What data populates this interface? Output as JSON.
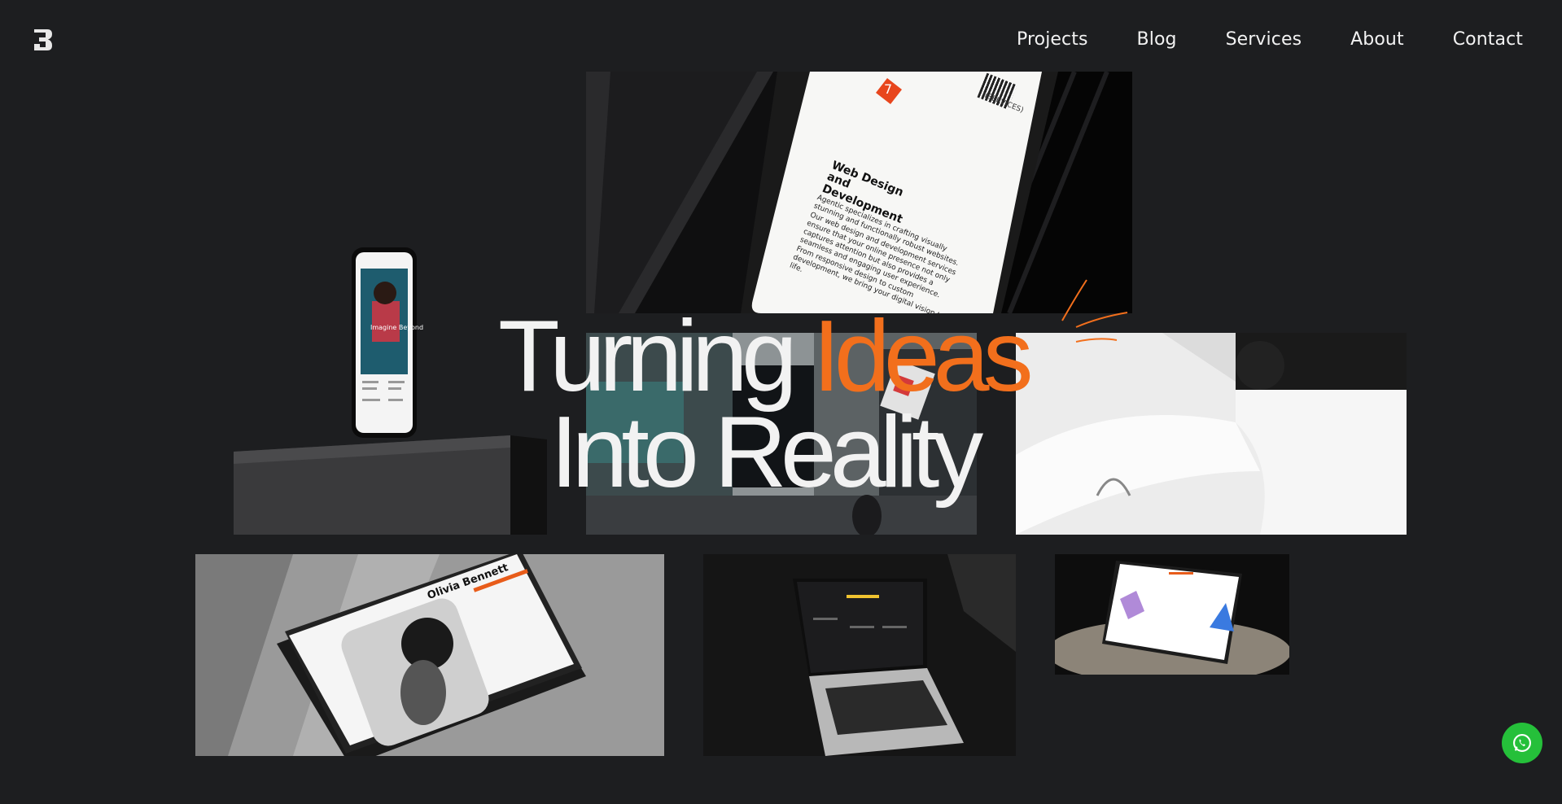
{
  "header": {
    "logo_icon": "brand-logo-icon",
    "nav": [
      {
        "label": "Projects"
      },
      {
        "label": "Blog"
      },
      {
        "label": "Services"
      },
      {
        "label": "About"
      },
      {
        "label": "Contact"
      }
    ]
  },
  "hero": {
    "word1": "Turning",
    "word2": "Ideas",
    "line2": "Into Reality",
    "accent_color": "#f26f1c"
  },
  "tiles": {
    "phone_card": {
      "badge": "7",
      "tag": "(SERVICES)",
      "title": "Web Design and Development",
      "body": "Agentic specializes in crafting visually stunning and functionally robust websites. Our web design and development services ensure that your online presence not only captures attention but also provides a seamless and engaging user experience. From responsive design to custom development, we bring your digital vision to life."
    },
    "phone_small": {
      "headline": "Imagine Beyond"
    },
    "tablet": {
      "name": "Olivia Bennett"
    }
  },
  "whatsapp": {
    "icon": "whatsapp-icon"
  }
}
